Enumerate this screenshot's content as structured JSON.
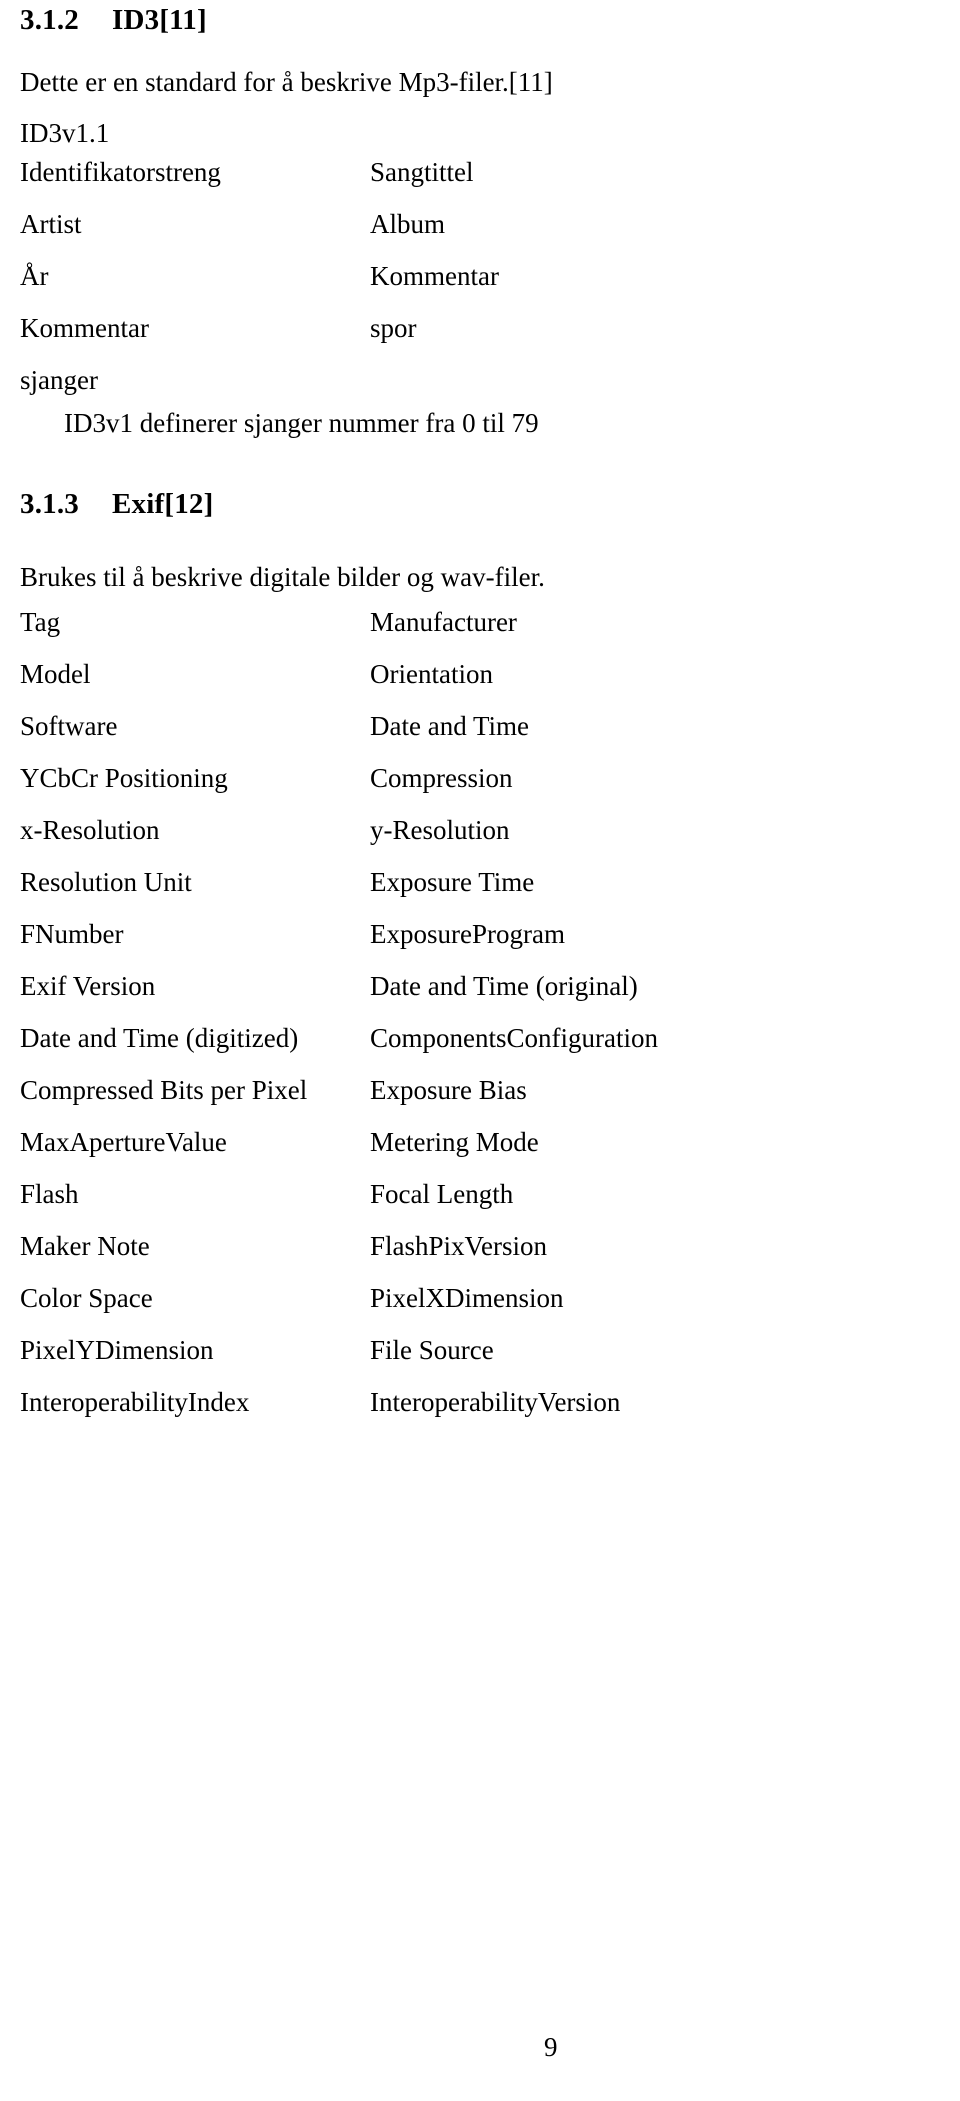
{
  "page": {
    "number": "9"
  },
  "sections": [
    {
      "number": "3.1.2",
      "title": "ID3[11]",
      "intro": "Dette er en standard for å beskrive Mp3-filer.[11]",
      "sublabel": "ID3v1.1",
      "note": "ID3v1 definerer sjanger nummer fra 0 til 79",
      "tags": [
        {
          "left": "Identifikatorstreng",
          "right": "Sangtittel"
        },
        {
          "left": "Artist",
          "right": "Album"
        },
        {
          "left": "År",
          "right": "Kommentar"
        },
        {
          "left": "Kommentar",
          "right": "spor"
        },
        {
          "left": "sjanger",
          "right": ""
        }
      ]
    },
    {
      "number": "3.1.3",
      "title": "Exif[12]",
      "intro": "Brukes til å beskrive digitale bilder og wav-filer.",
      "tags": [
        {
          "left": "Tag",
          "right": "Manufacturer"
        },
        {
          "left": "Model",
          "right": "Orientation"
        },
        {
          "left": "Software",
          "right": "Date and Time"
        },
        {
          "left": "YCbCr Positioning",
          "right": "Compression"
        },
        {
          "left": "x-Resolution",
          "right": "y-Resolution"
        },
        {
          "left": "Resolution Unit",
          "right": "Exposure Time"
        },
        {
          "left": "FNumber",
          "right": "ExposureProgram"
        },
        {
          "left": "Exif Version",
          "right": "Date and Time (original)"
        },
        {
          "left": "Date and Time (digitized)",
          "right": "ComponentsConfiguration"
        },
        {
          "left": "Compressed Bits per Pixel",
          "right": "Exposure Bias"
        },
        {
          "left": "MaxApertureValue",
          "right": "Metering Mode"
        },
        {
          "left": "Flash",
          "right": "Focal Length"
        },
        {
          "left": "Maker Note",
          "right": "FlashPixVersion"
        },
        {
          "left": "Color Space",
          "right": "PixelXDimension"
        },
        {
          "left": "PixelYDimension",
          "right": "File Source"
        },
        {
          "left": "InteroperabilityIndex",
          "right": "InteroperabilityVersion"
        }
      ]
    }
  ]
}
